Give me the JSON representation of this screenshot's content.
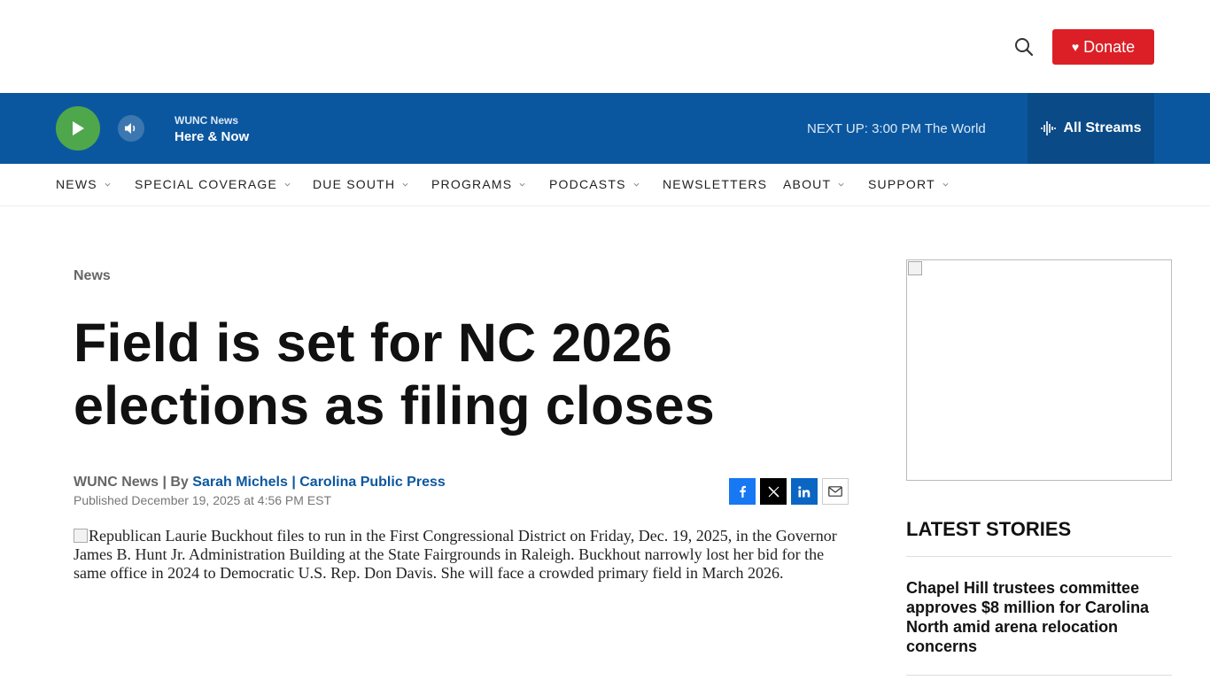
{
  "header": {
    "donate_label": "Donate",
    "search_icon": "search-icon"
  },
  "player": {
    "station": "WUNC News",
    "show": "Here & Now",
    "next_up_label": "NEXT UP:",
    "next_up_value": "3:00 PM The World",
    "streams_label": "All Streams"
  },
  "nav": {
    "items": [
      {
        "label": "NEWS"
      },
      {
        "label": "SPECIAL COVERAGE"
      },
      {
        "label": "DUE SOUTH"
      },
      {
        "label": "PROGRAMS"
      },
      {
        "label": "PODCASTS"
      },
      {
        "label": "NEWSLETTERS"
      },
      {
        "label": "ABOUT"
      },
      {
        "label": "SUPPORT"
      }
    ]
  },
  "article": {
    "section": "News",
    "headline": "Field is set for NC 2026 elections as filing closes",
    "byline_prefix": "WUNC News | By",
    "author": "Sarah Michels | Carolina Public Press",
    "published": "Published December 19, 2025 at 4:56 PM EST",
    "image_alt": "Republican Laurie Buckhout files to run in the First Congressional District on Friday, Dec. 19, 2025, in the Governor James B. Hunt Jr. Administration Building at the State Fairgrounds in Raleigh. Buckhout narrowly lost her bid for the same office in 2024 to Democratic U.S. Rep. Don Davis. She will face a crowded primary field in March 2026."
  },
  "sidebar": {
    "latest_heading": "LATEST STORIES",
    "stories": [
      {
        "title": "Chapel Hill trustees committee approves $8 million for Carolina North amid arena relocation concerns"
      }
    ]
  },
  "colors": {
    "brand_blue": "#0b579f",
    "donate_red": "#dc1f26",
    "play_green": "#4fa74b"
  }
}
